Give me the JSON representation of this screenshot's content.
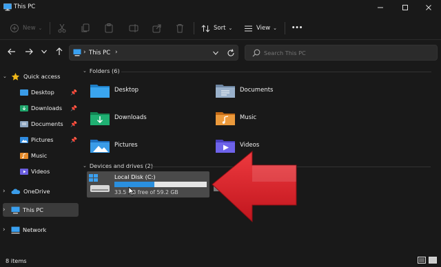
{
  "window": {
    "title": "This PC"
  },
  "toolbar": {
    "new_label": "New",
    "sort_label": "Sort",
    "view_label": "View",
    "more_label": "•••"
  },
  "address": {
    "location": "This PC"
  },
  "search": {
    "placeholder": "Search This PC"
  },
  "sidebar": {
    "items": [
      {
        "label": "Quick access"
      },
      {
        "label": "Desktop"
      },
      {
        "label": "Downloads"
      },
      {
        "label": "Documents"
      },
      {
        "label": "Pictures"
      },
      {
        "label": "Music"
      },
      {
        "label": "Videos"
      },
      {
        "label": "OneDrive"
      },
      {
        "label": "This PC"
      },
      {
        "label": "Network"
      }
    ]
  },
  "folders_group": {
    "label": "Folders (6)"
  },
  "folders": [
    {
      "label": "Desktop"
    },
    {
      "label": "Documents"
    },
    {
      "label": "Downloads"
    },
    {
      "label": "Music"
    },
    {
      "label": "Pictures"
    },
    {
      "label": "Videos"
    }
  ],
  "devices_group": {
    "label": "Devices and drives (2)"
  },
  "drive": {
    "name": "Local Disk (C:)",
    "free_text": "33.5 GB free of 59.2 GB",
    "free_gb": 33.5,
    "total_gb": 59.2
  },
  "status": {
    "item_count": "8 items"
  },
  "colors": {
    "accent": "#0078d4",
    "arrow": "#d4202a",
    "folder_blue": "#3a9ce8"
  }
}
